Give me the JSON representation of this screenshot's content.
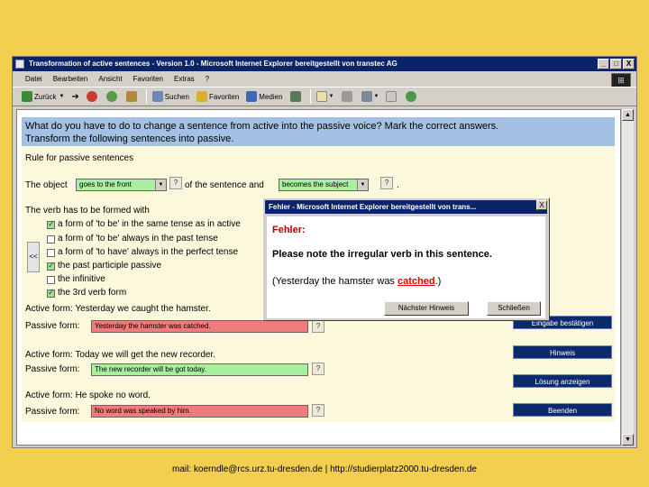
{
  "window": {
    "title": "Transformation of active sentences - Version 1.0 - Microsoft Internet Explorer bereitgestellt von transtec AG",
    "buttons": {
      "minimize": "_",
      "maximize": "□",
      "close": "X"
    }
  },
  "menu": [
    "Datei",
    "Bearbeiten",
    "Ansicht",
    "Favoriten",
    "Extras",
    "?"
  ],
  "toolbar": {
    "back": "Zurück",
    "search": "Suchen",
    "favorites": "Favoriten",
    "media": "Medien"
  },
  "header": {
    "line1": "What do you have to do to change a sentence from active into the passive voice? Mark the correct answers.",
    "line2": "Transform the following sentences into passive."
  },
  "rule": {
    "title": "Rule for passive sentences",
    "object_prefix": "The object",
    "object_select": "goes to the front",
    "object_middle": "of the sentence and",
    "subject_select": "becomes the subject",
    "suffix": "."
  },
  "verb": {
    "title": "The verb has to be formed with",
    "options": [
      {
        "label": "a form of 'to be' in the same tense as in active",
        "checked": true
      },
      {
        "label": "a form of 'to be' always in the past tense",
        "checked": false
      },
      {
        "label": "a form of 'to have' always in the perfect tense",
        "checked": false
      },
      {
        "label": "the past participle passive",
        "checked": true
      },
      {
        "label": "the infinitive",
        "checked": false
      },
      {
        "label": "the 3rd verb form",
        "checked": true
      }
    ]
  },
  "exercises": [
    {
      "active": "Active form: Yesterday we caught the hamster.",
      "passive_label": "Passive form:",
      "answer": "Yesterday the hamster was catched.",
      "status": "wrong"
    },
    {
      "active": "Active form: Today we will get the new recorder.",
      "passive_label": "Passive form:",
      "answer": "The new recorder will be got today.",
      "status": "correct"
    },
    {
      "active": "Active form: He spoke no word.",
      "passive_label": "Passive form:",
      "answer": "No word was speaked by him.",
      "status": "wrong"
    }
  ],
  "question_mark": "?",
  "side_tab": "<<",
  "nav_buttons": [
    "Eingabe bestätigen",
    "Hinweis",
    "Lösung anzeigen",
    "Beenden"
  ],
  "dialog": {
    "title": "Fehler - Microsoft Internet Explorer bereitgestellt von trans...",
    "close": "X",
    "heading": "Fehler:",
    "message": "Please note the irregular verb in this sentence.",
    "example_prefix": "(Yesterday the hamster was ",
    "example_error": "catched",
    "example_suffix": ".)",
    "next_button": "Nächster Hinweis",
    "close_button": "Schließen"
  },
  "footer": "mail: koerndle@rcs.urz.tu-dresden.de | http://studierplatz2000.tu-dresden.de",
  "colors": {
    "wrong": "#ef7c7c",
    "correct": "#a8f0a0",
    "accent": "#0b2a6a"
  }
}
